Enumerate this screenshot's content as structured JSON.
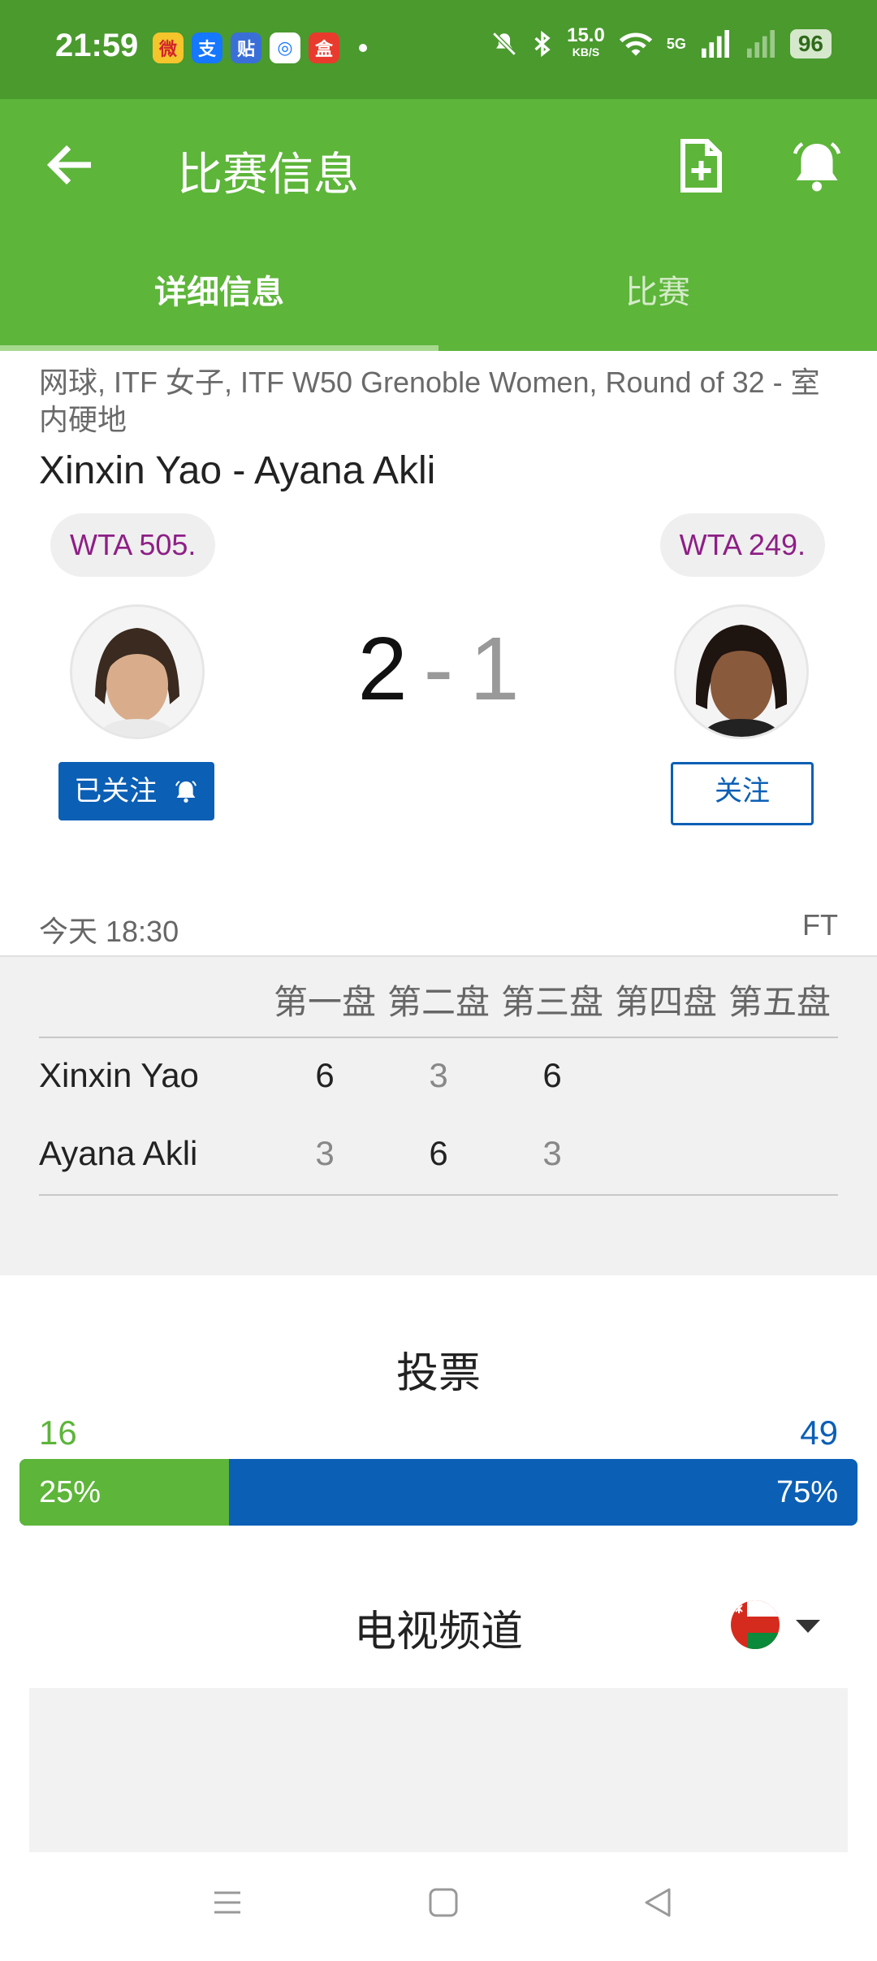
{
  "status_bar": {
    "time": "21:59",
    "apps": [
      {
        "name": "weibo-icon",
        "glyph": "微",
        "color": "#f5c52b"
      },
      {
        "name": "alipay-icon",
        "glyph": "支",
        "color": "#1677ff"
      },
      {
        "name": "tieba-icon",
        "glyph": "贴",
        "color": "#3b6fd8"
      },
      {
        "name": "browser-icon",
        "glyph": "◎",
        "color": "#ffffff"
      },
      {
        "name": "shop-icon",
        "glyph": "盒",
        "color": "#e83b2e"
      }
    ],
    "speed_value": "15.0",
    "speed_unit": "KB/S",
    "network": "5G",
    "battery": "96"
  },
  "app_bar": {
    "title": "比赛信息",
    "tabs": [
      "详细信息",
      "比赛"
    ],
    "active_tab": 0
  },
  "match": {
    "info_line": "网球, ITF 女子, ITF W50 Grenoble Women, Round of 32 - 室内硬地",
    "title": "Xinxin Yao - Ayana Akli",
    "player1": {
      "name": "Xinxin Yao",
      "rank": "WTA 505.",
      "follow_label": "已关注"
    },
    "player2": {
      "name": "Ayana Akli",
      "rank": "WTA 249.",
      "follow_label": "关注"
    },
    "score1": "2",
    "score_sep": "-",
    "score2": "1",
    "time": "今天 18:30",
    "status": "FT"
  },
  "sets": {
    "headers": [
      "第一盘",
      "第二盘",
      "第三盘",
      "第四盘",
      "第五盘"
    ],
    "rows": [
      {
        "name": "Xinxin Yao",
        "scores": [
          "6",
          "3",
          "6"
        ]
      },
      {
        "name": "Ayana Akli",
        "scores": [
          "3",
          "6",
          "3"
        ]
      }
    ]
  },
  "votes": {
    "title": "投票",
    "left_count": "16",
    "right_count": "49",
    "left_pct": "25%",
    "right_pct": "75%",
    "left_fraction": 0.25,
    "left_color": "#5db53a",
    "right_color": "#0b5fb5"
  },
  "tv": {
    "title": "电视频道",
    "flag": "oman-flag-icon"
  },
  "colors": {
    "status_bar": "#4a9a2e",
    "app_bar": "#5db53a",
    "accent_blue": "#0b5fb5",
    "rank_text": "#8e1f86"
  }
}
